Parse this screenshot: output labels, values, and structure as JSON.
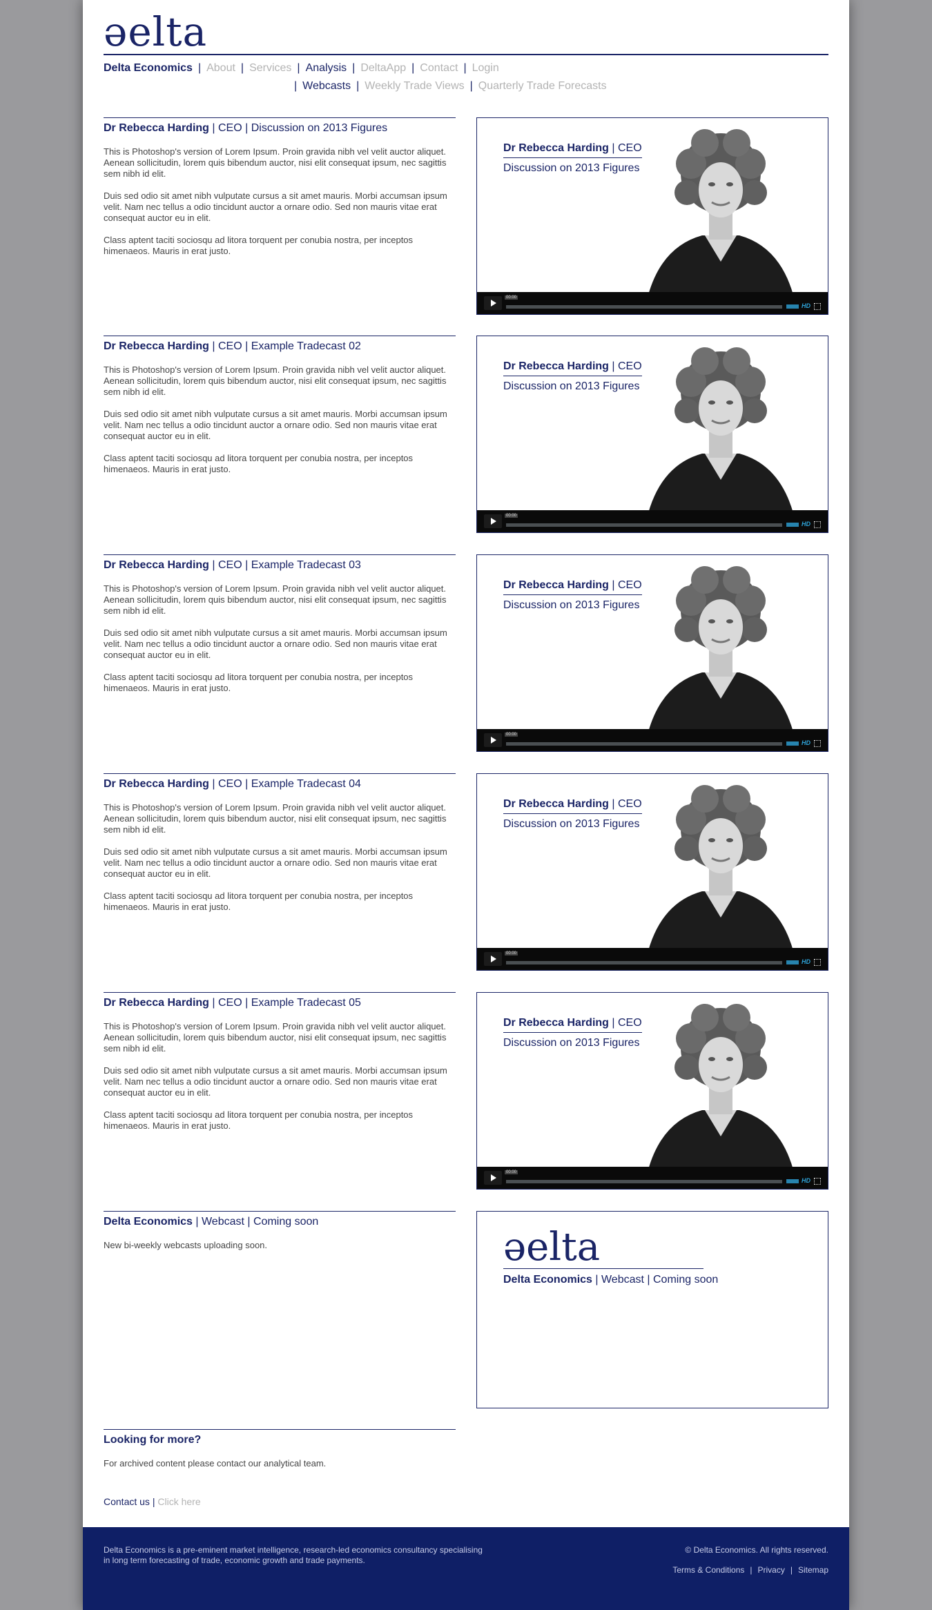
{
  "brand": {
    "logo": "ǝelta"
  },
  "nav": {
    "brand": "Delta Economics",
    "items": [
      "About",
      "Services",
      "Analysis",
      "DeltaApp",
      "Contact",
      "Login"
    ],
    "separator": "|"
  },
  "subnav": {
    "items": [
      "Webcasts",
      "Weekly Trade Views",
      "Quarterly Trade Forecasts"
    ],
    "separator": "|"
  },
  "webcasts": [
    {
      "name": "Dr Rebecca Harding",
      "rest": " | CEO | Discussion on 2013 Figures"
    },
    {
      "name": "Dr Rebecca Harding",
      "rest": " | CEO | Example Tradecast 02"
    },
    {
      "name": "Dr Rebecca Harding",
      "rest": " | CEO | Example Tradecast 03"
    },
    {
      "name": "Dr Rebecca Harding",
      "rest": " | CEO | Example Tradecast 04"
    },
    {
      "name": "Dr Rebecca Harding",
      "rest": " | CEO | Example Tradecast 05"
    }
  ],
  "body_paragraphs": [
    "This is Photoshop's version  of Lorem Ipsum. Proin gravida nibh vel velit auctor aliquet. Aenean sollicitudin, lorem quis bibendum auctor, nisi elit consequat ipsum, nec sagittis sem nibh id elit.",
    "Duis sed odio sit amet nibh vulputate cursus a sit amet mauris. Morbi accumsan ipsum velit. Nam nec tellus a odio tincidunt auctor a ornare odio. Sed non  mauris vitae erat consequat auctor eu in elit.",
    "Class aptent taciti sociosqu ad litora torquent per conubia nostra, per inceptos himenaeos. Mauris in erat justo."
  ],
  "video_overlay": {
    "name": "Dr Rebecca Harding",
    "role": " | CEO",
    "subtitle": "Discussion on 2013 Figures",
    "time": "00:00",
    "hd": "HD"
  },
  "coming_soon": {
    "brand": "Delta Economics",
    "rest": " | Webcast | Coming soon",
    "body": "New bi-weekly webcasts uploading soon.",
    "logo": "ǝelta"
  },
  "more": {
    "title": "Looking for more?",
    "body": "For archived content please contact our analytical team.",
    "contact_label": "Contact us",
    "separator": "|",
    "click_label": "Click here"
  },
  "footer": {
    "about": "Delta Economics is a pre-eminent market intelligence, research-led economics consultancy specialising in long term forecasting of trade, economic growth and trade payments.",
    "copyright": "© Delta Economics. All rights reserved.",
    "links": [
      "Terms & Conditions",
      "Privacy",
      "Sitemap"
    ],
    "separator": "|"
  },
  "colors": {
    "navy": "#1a2466",
    "footer_bg": "#0f1f66",
    "muted": "#b3b3b3",
    "player_accent": "#2ea3d8"
  }
}
